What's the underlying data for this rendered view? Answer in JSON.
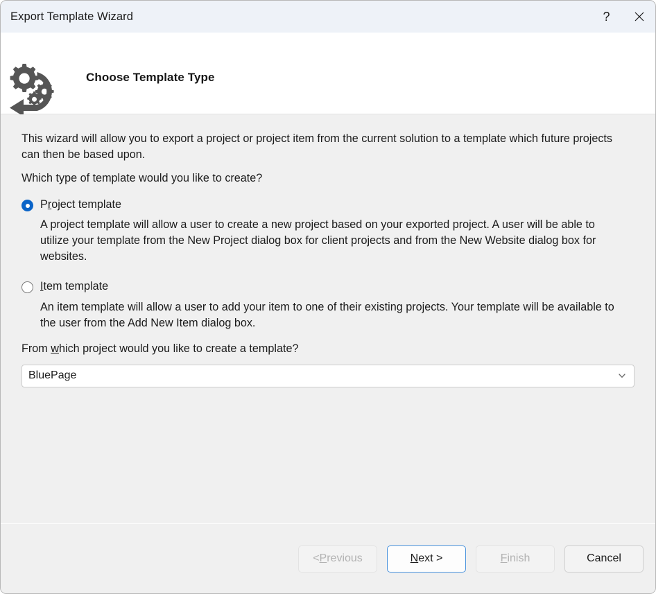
{
  "window": {
    "title": "Export Template Wizard",
    "help_icon": "question-mark-icon",
    "help_label": "?",
    "close_icon": "close-icon"
  },
  "header": {
    "icon": "gears-export-arrow-icon",
    "title": "Choose Template Type"
  },
  "body": {
    "intro": "This wizard will allow you to export a project or project item from the current solution to a template which future projects can then be based upon.",
    "question": "Which type of template would you like to create?",
    "options": [
      {
        "label_before": "P",
        "label_accel": "r",
        "label_after": "oject template",
        "label_full": "Project template",
        "selected": true,
        "description": "A project template will allow a user to create a new project based on your exported project. A user will be able to utilize your template from the New Project dialog box for client projects and from the New Website dialog box for websites."
      },
      {
        "label_before": "",
        "label_accel": "I",
        "label_after": "tem template",
        "label_full": "Item template",
        "selected": false,
        "description": "An item template will allow a user to add your item to one of their existing projects. Your template will be available to the user from the Add New Item dialog box."
      }
    ],
    "project_prompt_before": "From ",
    "project_prompt_accel": "w",
    "project_prompt_after": "hich project would you like to create a template?",
    "project_prompt_full": "From which project would you like to create a template?",
    "project_combo": {
      "value": "BluePage",
      "arrow_icon": "chevron-down-icon"
    }
  },
  "footer": {
    "buttons": [
      {
        "label": "< Previous",
        "state": "disabled",
        "accel": "P"
      },
      {
        "label": "Next >",
        "state": "focused",
        "accel": "N"
      },
      {
        "label": "Finish",
        "state": "disabled",
        "accel": "F"
      },
      {
        "label": "Cancel",
        "state": "default",
        "accel": ""
      }
    ],
    "previous_pre": "< ",
    "previous_accel": "P",
    "previous_post": "revious",
    "next_accel": "N",
    "next_post": "ext >",
    "finish_accel": "F",
    "finish_post": "inish",
    "cancel_label": "Cancel"
  },
  "colors": {
    "titlebar_bg": "#eef2f8",
    "body_bg": "#f0f0f0",
    "accent": "#0a64c8",
    "focus_border": "#4a93dd",
    "icon_gray": "#555555"
  }
}
